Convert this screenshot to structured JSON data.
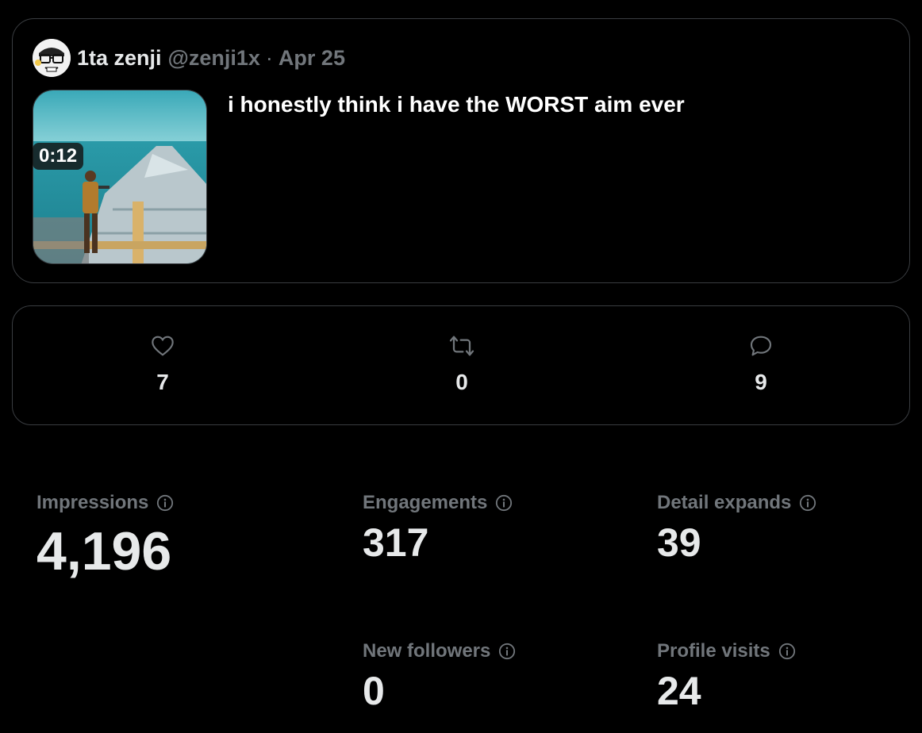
{
  "tweet": {
    "display_name": "1ta zenji",
    "handle": "@zenji1x",
    "separator": "·",
    "date": "Apr 25",
    "text": "i honestly think i have the WORST aim ever",
    "media_duration": "0:12"
  },
  "actions": {
    "likes": "7",
    "retweets": "0",
    "replies": "9"
  },
  "metrics": {
    "impressions": {
      "label": "Impressions",
      "value": "4,196"
    },
    "engagements": {
      "label": "Engagements",
      "value": "317"
    },
    "detail_expands": {
      "label": "Detail expands",
      "value": "39"
    },
    "new_followers": {
      "label": "New followers",
      "value": "0"
    },
    "profile_visits": {
      "label": "Profile visits",
      "value": "24"
    }
  },
  "icons": {
    "like": "heart-icon",
    "retweet": "retweet-icon",
    "reply": "reply-icon",
    "info": "info-icon"
  },
  "colors": {
    "background": "#000000",
    "border": "#3a3d41",
    "text_primary": "#e7e9ea",
    "text_secondary": "#71767b"
  }
}
